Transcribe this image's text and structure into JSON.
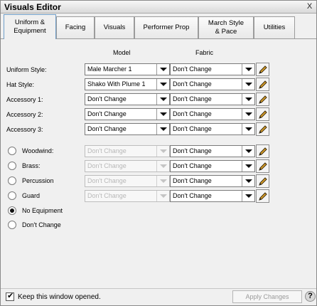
{
  "window": {
    "title": "Visuals Editor",
    "close_glyph": "X"
  },
  "tabs": [
    {
      "label": "Uniform &\nEquipment",
      "active": true
    },
    {
      "label": "Facing"
    },
    {
      "label": "Visuals"
    },
    {
      "label": "Performer Prop"
    },
    {
      "label": "March Style\n& Pace"
    },
    {
      "label": "Utilities"
    }
  ],
  "columns": {
    "model": "Model",
    "fabric": "Fabric"
  },
  "rows": [
    {
      "label": "Uniform Style:",
      "model": "Male Marcher 1",
      "fabric": "Don't Change"
    },
    {
      "label": "Hat Style:",
      "model": "Shako With Plume 1",
      "fabric": "Don't Change"
    },
    {
      "label": "Accessory 1:",
      "model": "Don't Change",
      "fabric": "Don't Change"
    },
    {
      "label": "Accessory 2:",
      "model": "Don't Change",
      "fabric": "Don't Change"
    },
    {
      "label": "Accessory 3:",
      "model": "Don't Change",
      "fabric": "Don't Change"
    }
  ],
  "equipment": [
    {
      "label": "Woodwind:",
      "model": "Don't Change",
      "fabric": "Don't Change",
      "checked": false
    },
    {
      "label": "Brass:",
      "model": "Don't Change",
      "fabric": "Don't Change",
      "checked": false
    },
    {
      "label": "Percussion",
      "model": "Don't Change",
      "fabric": "Don't Change",
      "checked": false
    },
    {
      "label": "Guard",
      "model": "Don't Change",
      "fabric": "Don't Change",
      "checked": false
    },
    {
      "label": "No Equipment",
      "checked": true
    },
    {
      "label": "Don't Change",
      "checked": false
    }
  ],
  "footer": {
    "keep_open_label": "Keep this window opened.",
    "keep_open_checked": true,
    "apply_label": "Apply Changes",
    "help_glyph": "?"
  },
  "icons": {
    "edit": "pencil-icon",
    "dropdown": "chevron-down-icon",
    "help": "help-icon",
    "close": "close-icon"
  },
  "colors": {
    "active_tab_border": "#6f9ec9",
    "pencil_body": "#e0a42a"
  }
}
